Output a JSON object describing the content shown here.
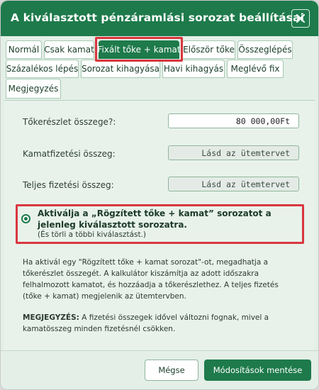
{
  "dialog": {
    "title": "A kiválasztott pénzáramlási sorozat beállításai",
    "close_icon": "close-icon"
  },
  "tabs": [
    {
      "label": "Normál",
      "active": false
    },
    {
      "label": "Csak kamat",
      "active": false
    },
    {
      "label": "Fixált tőke + kamat",
      "active": true
    },
    {
      "label": "Először tőke",
      "active": false
    },
    {
      "label": "Összeglépés",
      "active": false
    },
    {
      "label": "Százalékos lépés",
      "active": false
    },
    {
      "label": "Sorozat kihagyása",
      "active": false
    },
    {
      "label": "Havi kihagyás",
      "active": false
    },
    {
      "label": "Meglévő fix",
      "active": false
    },
    {
      "label": "Megjegyzés",
      "active": false
    }
  ],
  "form": {
    "principal_label": "Tőkerészlet összege?:",
    "principal_value": "80 000,00Ft",
    "interest_label": "Kamatfizetési összeg:",
    "interest_value": "Lásd az ütemtervet",
    "total_label": "Teljes fizetési összeg:",
    "total_value": "Lásd az ütemtervet"
  },
  "option": {
    "title": "Aktiválja a „Rögzített tőke + kamat” sorozatot a jelenleg kiválasztott sorozatra.",
    "subtitle": "(És törli a többi kiválasztást.)",
    "selected": true
  },
  "info_text": "Ha aktivál egy \"Rögzített tőke + kamat sorozat\"-ot, megadhatja a tőkerészlet összegét. A kalkulátor kiszámítja az adott időszakra felhalmozott kamatot, és hozzáadja a tőkerészlethez. A teljes fizetés (tőke + kamat) megjelenik az ütemtervben.",
  "note": {
    "label": "MEGJEGYZÉS:",
    "text": " A fizetési összegek idővel változni fognak, mivel a kamatösszeg minden fizetésnél csökken."
  },
  "buttons": {
    "cancel": "Mégse",
    "save": "Módosítások mentése"
  },
  "colors": {
    "primary": "#1e7a4b",
    "highlight": "#d9363e",
    "panel_bg": "#e3efe7"
  }
}
